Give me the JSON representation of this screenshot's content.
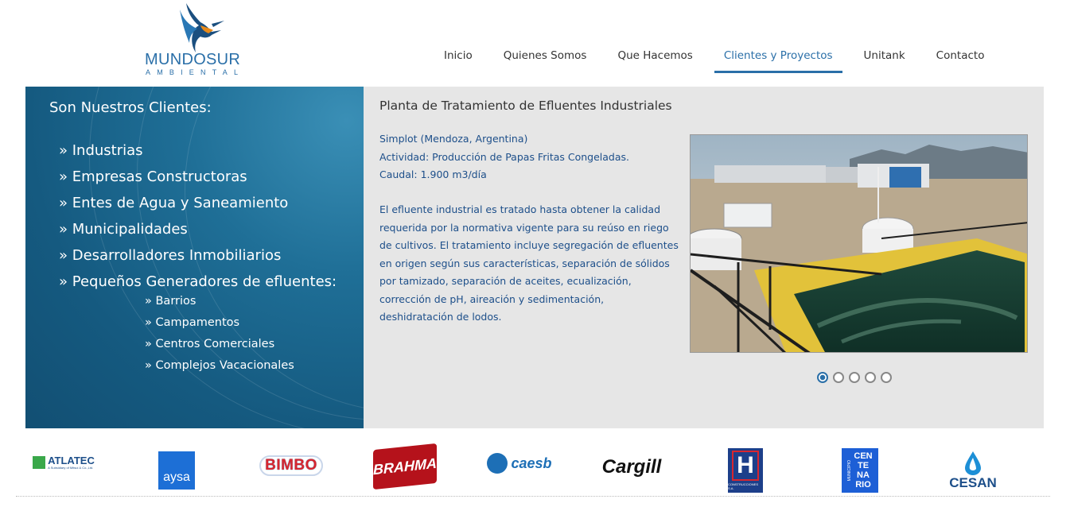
{
  "brand": {
    "name": "MUNDOSUR",
    "tagline": "AMBIENTAL"
  },
  "nav": [
    {
      "label": "Inicio",
      "active": false
    },
    {
      "label": "Quienes Somos",
      "active": false
    },
    {
      "label": "Que Hacemos",
      "active": false
    },
    {
      "label": "Clientes y Proyectos",
      "active": true
    },
    {
      "label": "Unitank",
      "active": false
    },
    {
      "label": "Contacto",
      "active": false
    }
  ],
  "clients_panel": {
    "heading": "Son Nuestros Clientes:",
    "categories": [
      "» Industrias",
      "» Empresas Constructoras",
      "» Entes de Agua y Saneamiento",
      "» Municipalidades",
      "» Desarrolladores Inmobiliarios",
      "» Pequeños Generadores de efluentes:"
    ],
    "subcategories": [
      "» Barrios",
      "» Campamentos",
      "» Centros Comerciales",
      "» Complejos Vacacionales"
    ]
  },
  "project": {
    "title": "Planta de Tratamiento de Efluentes Industriales",
    "client": "Simplot (Mendoza, Argentina)",
    "activity": "Actividad: Producción de Papas Fritas Congeladas.",
    "flow": "Caudal: 1.900 m3/día",
    "description_lines": [
      "El efluente industrial es tratado hasta obtener la calidad",
      "requerida por la normativa vigente para su reúso en riego",
      "de cultivos. El tratamiento incluye segregación de efluentes",
      "en origen según sus características, separación de sólidos",
      "por tamizado, separación de aceites, ecualización,",
      "corrección de pH, aireación y sedimentación,",
      "deshidratación de lodos."
    ],
    "slides": 5,
    "active_slide": 1
  },
  "client_logos": {
    "atlatec": {
      "name": "ATLATEC",
      "sub": "A Subsidiary of Mitsui & Co.,Ltd."
    },
    "aysa": "aysa",
    "bimbo": "BIMBO",
    "brahma": "BRAHMA",
    "caesb": "caesb",
    "cargill": "Cargill",
    "hd": {
      "mark": "H",
      "sub": "CONSTRUCCIONES S.A."
    },
    "centenario": {
      "word": "CEN TE NA RIO",
      "side": "MUNICIPIO"
    },
    "cesan": "CESAN"
  },
  "colors": {
    "accent": "#2a6fa8",
    "panel_blue": "#1f6f97",
    "text_blue": "#1d4f8a",
    "panel_gray": "#e6e6e6"
  }
}
